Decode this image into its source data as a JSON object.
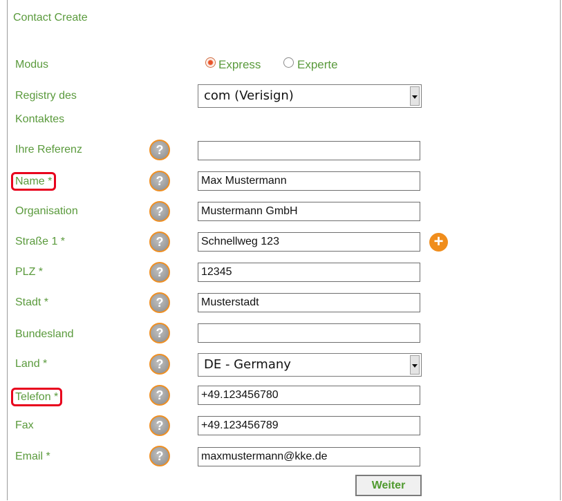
{
  "form": {
    "title": "Contact Create",
    "modus": {
      "label": "Modus",
      "options": [
        "Express",
        "Experte"
      ],
      "selected": "Express"
    },
    "registry": {
      "label_line1": "Registry des",
      "label_line2": "Kontaktes",
      "value": "com (Verisign)"
    },
    "fields": {
      "referenz": {
        "label": "Ihre Referenz",
        "value": ""
      },
      "name": {
        "label": "Name *",
        "value": "Max Mustermann"
      },
      "organisation": {
        "label": "Organisation",
        "value": "Mustermann GmbH"
      },
      "strasse": {
        "label": "Straße 1 *",
        "value": "Schnellweg 123"
      },
      "plz": {
        "label": "PLZ *",
        "value": "12345"
      },
      "stadt": {
        "label": "Stadt *",
        "value": "Musterstadt"
      },
      "bundesland": {
        "label": "Bundesland",
        "value": ""
      },
      "land": {
        "label": "Land *",
        "value": "DE - Germany"
      },
      "telefon": {
        "label": "Telefon *",
        "value": "+49.123456780"
      },
      "fax": {
        "label": "Fax",
        "value": "+49.123456789"
      },
      "email": {
        "label": "Email *",
        "value": "maxmustermann@kke.de"
      }
    },
    "help_glyph": "?",
    "add_glyph": "+",
    "submit_label": "Weiter"
  },
  "colors": {
    "label_green": "#5a9a3c",
    "highlight_red": "#e8001c",
    "accent_orange": "#f08d1c"
  },
  "icons": {
    "help": "question-circle-icon",
    "add": "plus-circle-icon"
  }
}
